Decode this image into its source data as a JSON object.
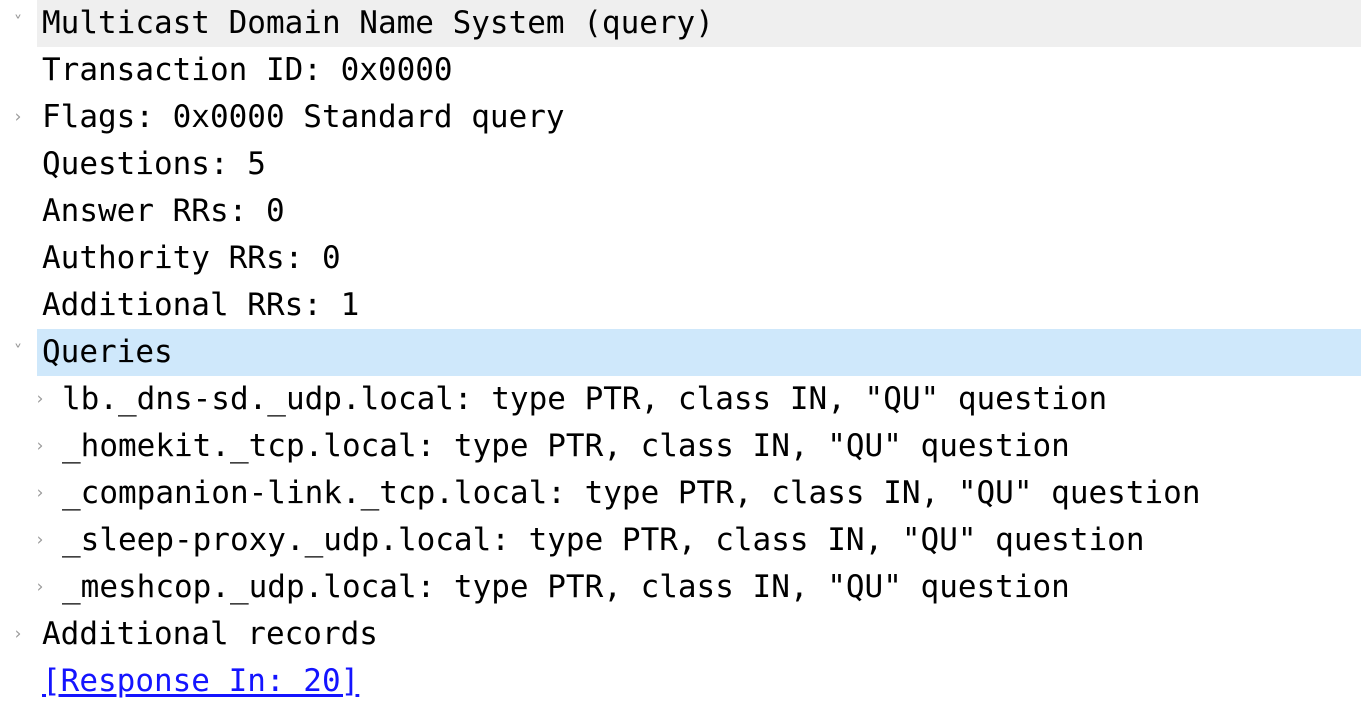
{
  "panel": {
    "name": "wireshark-packet-details",
    "selection_color": "#cfe8fb",
    "header_color": "#efefef",
    "link_color": "#1414ff",
    "expand_glyph": "˅",
    "collapse_glyph": "›"
  },
  "rows": [
    {
      "id": "mdns-protocol",
      "label": "Multicast Domain Name System (query)",
      "indent": 0,
      "toggle": "expanded",
      "state": "header-highlight",
      "link": false
    },
    {
      "id": "transaction-id",
      "label": "Transaction ID: 0x0000",
      "indent": 0,
      "toggle": "none",
      "state": "normal",
      "link": false
    },
    {
      "id": "flags",
      "label": "Flags: 0x0000 Standard query",
      "indent": 0,
      "toggle": "collapsed",
      "state": "normal",
      "link": false
    },
    {
      "id": "questions",
      "label": "Questions: 5",
      "indent": 0,
      "toggle": "none",
      "state": "normal",
      "link": false
    },
    {
      "id": "answer-rrs",
      "label": "Answer RRs: 0",
      "indent": 0,
      "toggle": "none",
      "state": "normal",
      "link": false
    },
    {
      "id": "authority-rrs",
      "label": "Authority RRs: 0",
      "indent": 0,
      "toggle": "none",
      "state": "normal",
      "link": false
    },
    {
      "id": "additional-rrs",
      "label": "Additional RRs: 1",
      "indent": 0,
      "toggle": "none",
      "state": "normal",
      "link": false
    },
    {
      "id": "queries",
      "label": "Queries",
      "indent": 0,
      "toggle": "expanded",
      "state": "selected",
      "link": false
    },
    {
      "id": "query-lb-dns-sd-udp",
      "label": "lb._dns-sd._udp.local: type PTR, class IN, \"QU\" question",
      "indent": 1,
      "toggle": "collapsed",
      "state": "normal",
      "link": false
    },
    {
      "id": "query-homekit-tcp",
      "label": "_homekit._tcp.local: type PTR, class IN, \"QU\" question",
      "indent": 1,
      "toggle": "collapsed",
      "state": "normal",
      "link": false
    },
    {
      "id": "query-companion-link-tcp",
      "label": "_companion-link._tcp.local: type PTR, class IN, \"QU\" question",
      "indent": 1,
      "toggle": "collapsed",
      "state": "normal",
      "link": false
    },
    {
      "id": "query-sleep-proxy-udp",
      "label": "_sleep-proxy._udp.local: type PTR, class IN, \"QU\" question",
      "indent": 1,
      "toggle": "collapsed",
      "state": "normal",
      "link": false
    },
    {
      "id": "query-meshcop-udp",
      "label": "_meshcop._udp.local: type PTR, class IN, \"QU\" question",
      "indent": 1,
      "toggle": "collapsed",
      "state": "normal",
      "link": false
    },
    {
      "id": "additional-records",
      "label": "Additional records",
      "indent": 0,
      "toggle": "collapsed",
      "state": "normal",
      "link": false
    },
    {
      "id": "response-in",
      "label": "[Response In: 20]",
      "indent": 0,
      "toggle": "none",
      "state": "normal",
      "link": true
    }
  ]
}
